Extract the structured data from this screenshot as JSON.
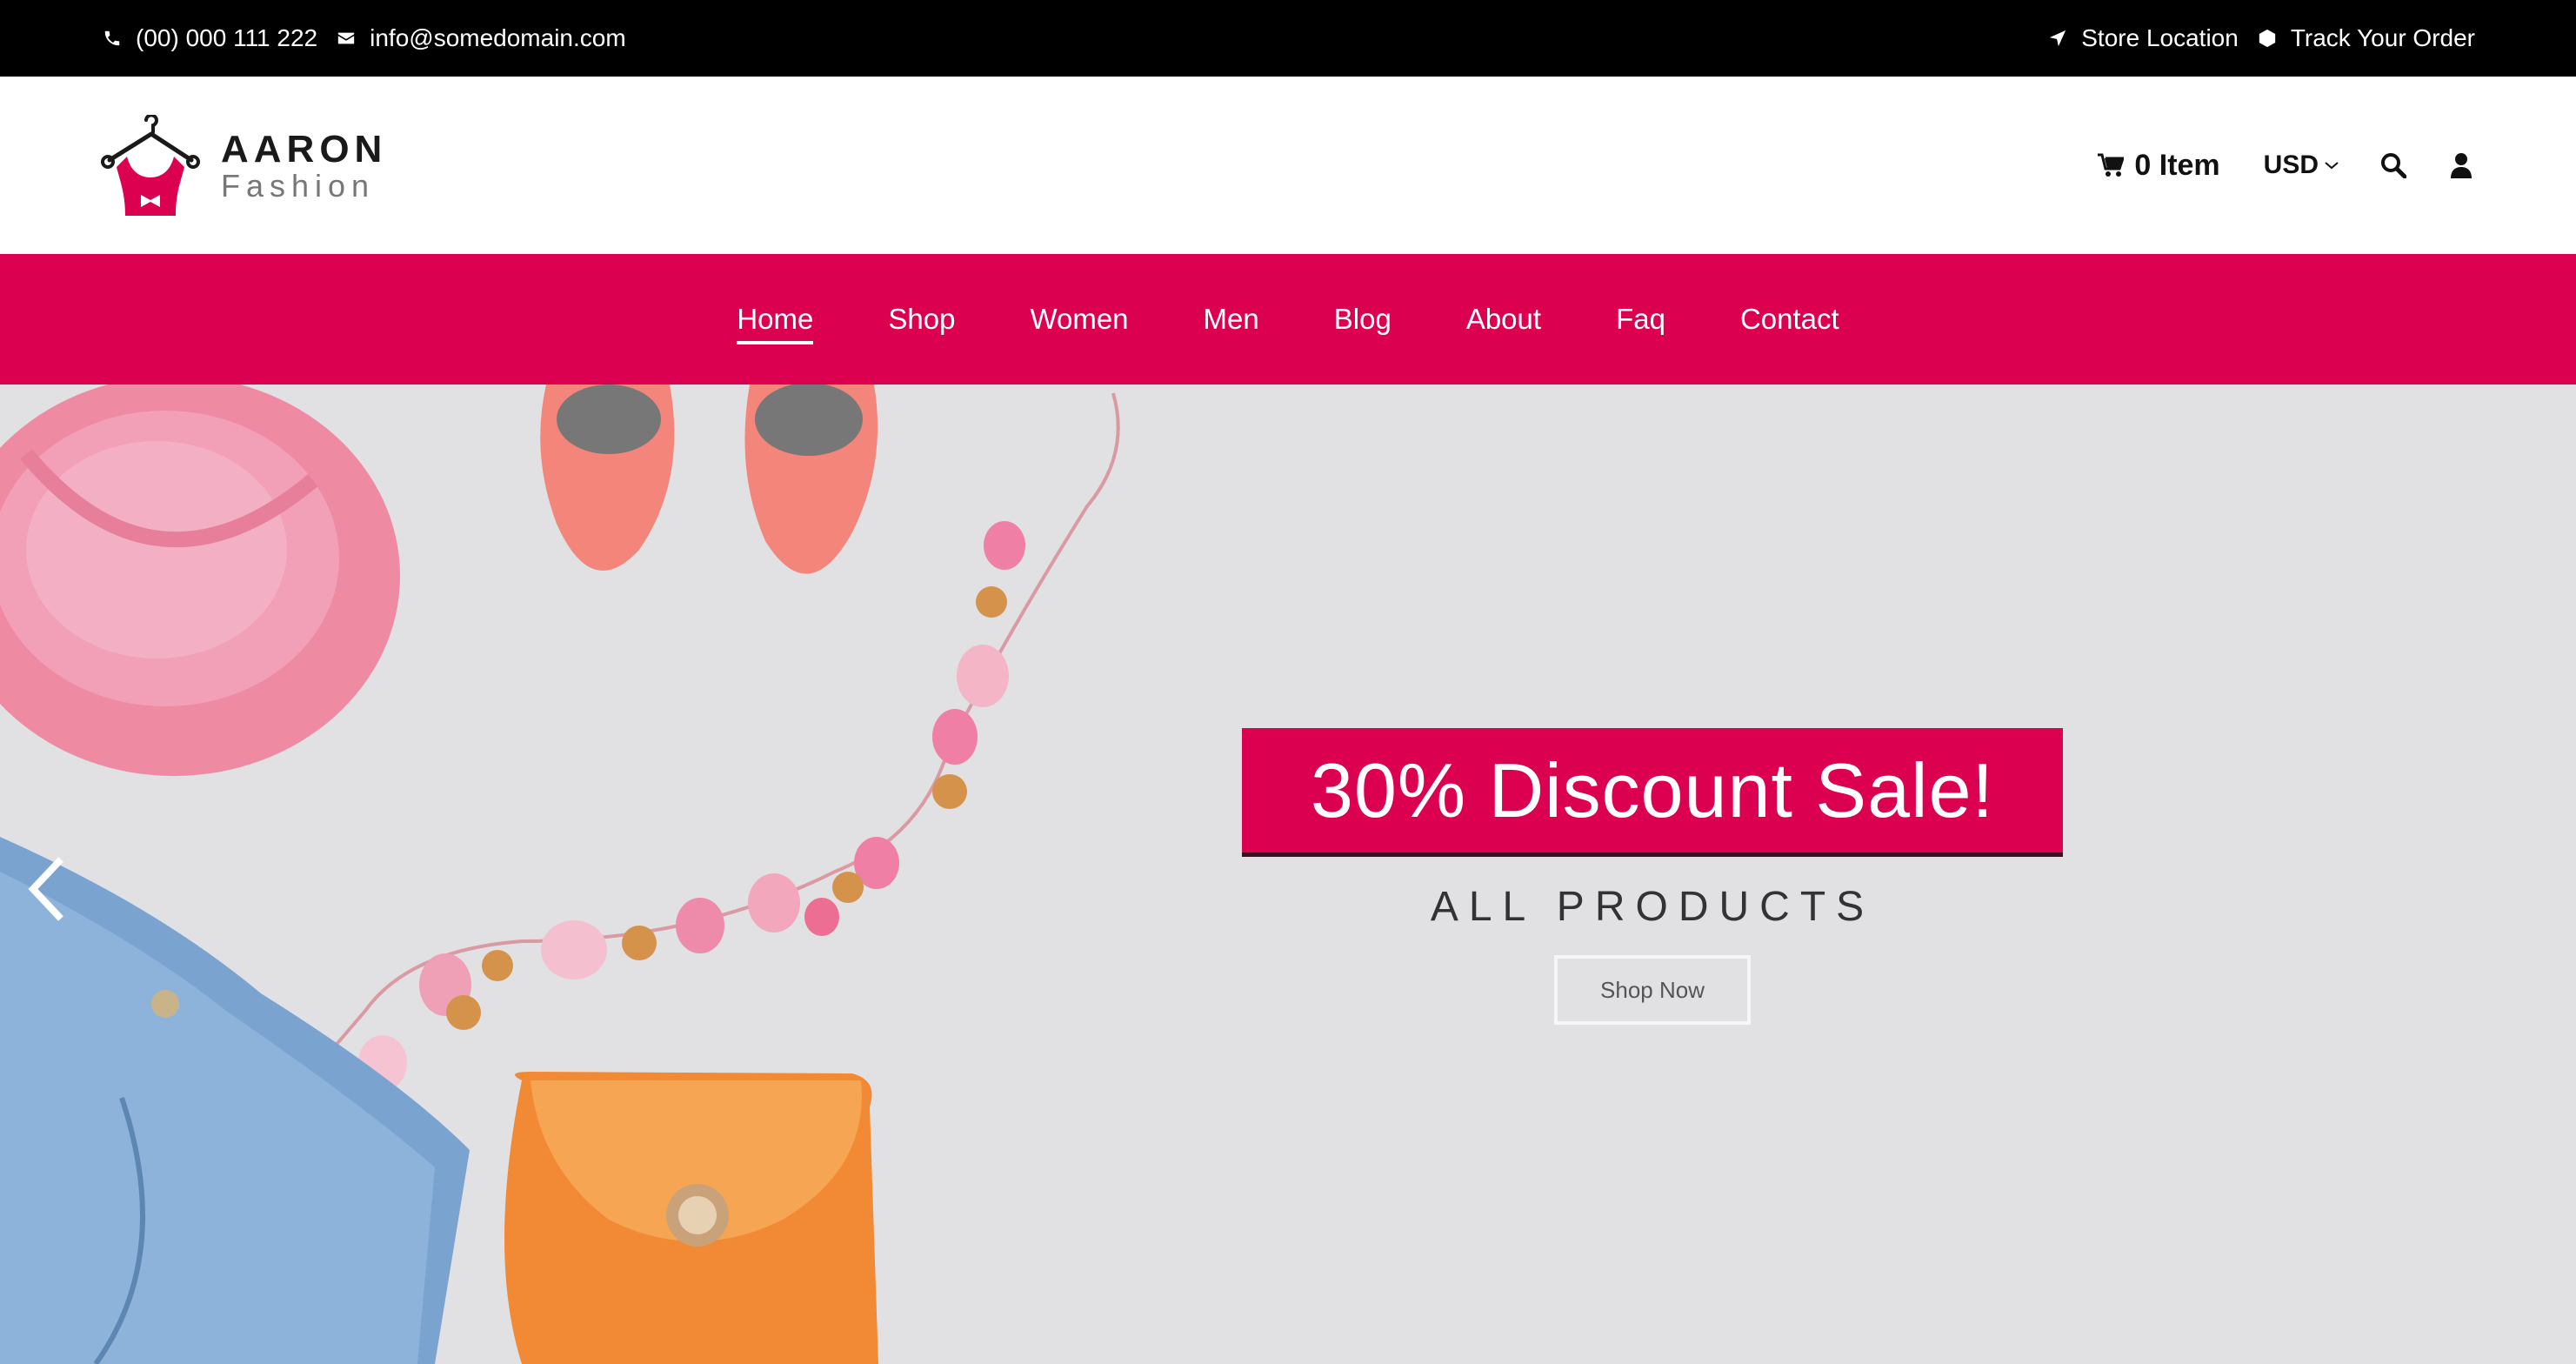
{
  "topbar": {
    "phone": "(00) 000 111 222",
    "email": "info@somedomain.com",
    "store_location": "Store Location",
    "track_order": "Track Your Order"
  },
  "header": {
    "logo_name": "AARON",
    "logo_sub": "Fashion",
    "cart_label": "0 Item",
    "currency": "USD"
  },
  "nav": {
    "items": [
      "Home",
      "Shop",
      "Women",
      "Men",
      "Blog",
      "About",
      "Faq",
      "Contact"
    ],
    "active": "Home"
  },
  "hero": {
    "headline": "30% Discount Sale!",
    "subtitle": "ALL PRODUCTS",
    "cta": "Shop Now"
  },
  "colors": {
    "brand": "#dc0050",
    "topbar": "#000000",
    "hero_bg": "#e1e0e3"
  },
  "icons": {
    "phone": "phone-icon",
    "email": "envelope-icon",
    "location": "location-arrow-icon",
    "track": "hexagon-icon",
    "cart": "cart-icon",
    "currency_caret": "chevron-down-icon",
    "search": "search-icon",
    "user": "user-icon",
    "prev": "chevron-left-icon"
  }
}
